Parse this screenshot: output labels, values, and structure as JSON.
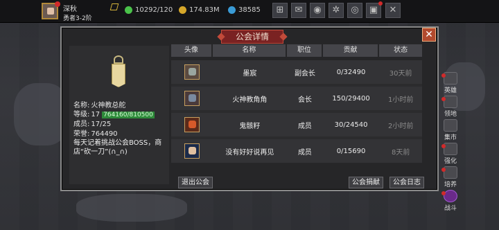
{
  "player": {
    "name": "深秋",
    "rank": "勇者3-2阶"
  },
  "resources": [
    {
      "icon": "energy-icon",
      "value": "10292/120",
      "color": "#4ac24a"
    },
    {
      "icon": "gold-coin-icon",
      "value": "174.83M",
      "color": "#d6a72a"
    },
    {
      "icon": "gem-icon",
      "value": "38585",
      "color": "#3a9bd6"
    }
  ],
  "toolbar": [
    {
      "icon": "shop-cart-icon",
      "glyph": "⊞"
    },
    {
      "icon": "mail-icon",
      "glyph": "✉"
    },
    {
      "icon": "gamepad-icon",
      "glyph": "◉"
    },
    {
      "icon": "settings-gear-icon",
      "glyph": "✲"
    },
    {
      "icon": "color-wheel-icon",
      "glyph": "◎"
    },
    {
      "icon": "gift-icon",
      "glyph": "▣"
    },
    {
      "icon": "battle-swords-icon",
      "glyph": "✕"
    }
  ],
  "panel": {
    "title": "公会详情",
    "close_glyph": "✕"
  },
  "guild": {
    "name_label": "名称:",
    "name": "火神教总舵",
    "level_label": "等级:",
    "level": "17",
    "exp": "764160/810500",
    "members_label": "成员:",
    "members": "17/25",
    "honor_label": "荣誉:",
    "honor": "764490",
    "notice": "每天记着挑战公会BOSS，商店“砍一刀”(∩_∩)"
  },
  "table": {
    "headers": [
      "头像",
      "名称",
      "职位",
      "贡献",
      "状态"
    ],
    "rows": [
      {
        "name": "墨宸",
        "position": "副会长",
        "contribution": "0/32490",
        "status": "30天前",
        "portrait_color": "#9aa6a0"
      },
      {
        "name": "火神教角角",
        "position": "会长",
        "contribution": "150/29400",
        "status": "1小时前",
        "portrait_color": "#7a8aa0"
      },
      {
        "name": "鬼骸籽",
        "position": "成员",
        "contribution": "30/24540",
        "status": "2小时前",
        "portrait_color": "#d65a2a"
      },
      {
        "name": "没有好好说再见",
        "position": "成员",
        "contribution": "0/15690",
        "status": "8天前",
        "portrait_color": "#3a4a8a"
      }
    ]
  },
  "buttons": {
    "leave": "退出公会",
    "donate": "公会捐献",
    "log": "公会日志"
  },
  "side_menu": [
    {
      "label": "英雄",
      "icon": "hero-icon"
    },
    {
      "label": "领地",
      "icon": "territory-icon"
    },
    {
      "label": "集市",
      "icon": "market-icon"
    },
    {
      "label": "强化",
      "icon": "enhance-icon"
    },
    {
      "label": "培养",
      "icon": "train-icon"
    },
    {
      "label": "战斗",
      "icon": "battle-portal-icon"
    }
  ]
}
